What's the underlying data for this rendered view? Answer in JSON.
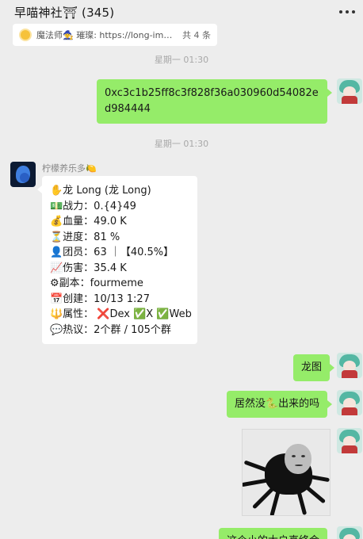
{
  "header": {
    "title": "早喵神社⛩ (345)",
    "more_icon": "more-dots-icon"
  },
  "pinned": {
    "text": "魔法师🧙 璀璨: https://long-ima...",
    "count": "共 4 条",
    "icon": "sun-icon"
  },
  "messages": {
    "timestamp1": "星期一 01:30",
    "hash": "0xc3c1b25ff8c3f828f36a030960d54082ed984444",
    "timestamp2": "星期一 01:30",
    "sender_name": "柠檬养乐多🍋",
    "card": [
      "✋龙 Long (龙 Long)",
      "💵战力：0.{4}49",
      "💰血量：49.0 K",
      "⏳进度：81 %",
      "👤团员：63 ｜【40.5%】",
      "📈伤害：35.4 K",
      "⚙副本：fourmeme",
      "📅创建：10/13 1:27",
      "🔱属性： ❌Dex ✅X ✅Web",
      "💬热议：2个群 / 105个群"
    ],
    "short1": "龙图",
    "short2": "居然没🐍出来的吗",
    "partial": "这个小的大户真终会"
  },
  "colors": {
    "my_bubble": "#95ec69",
    "their_bubble": "#ffffff",
    "background": "#ededed"
  }
}
